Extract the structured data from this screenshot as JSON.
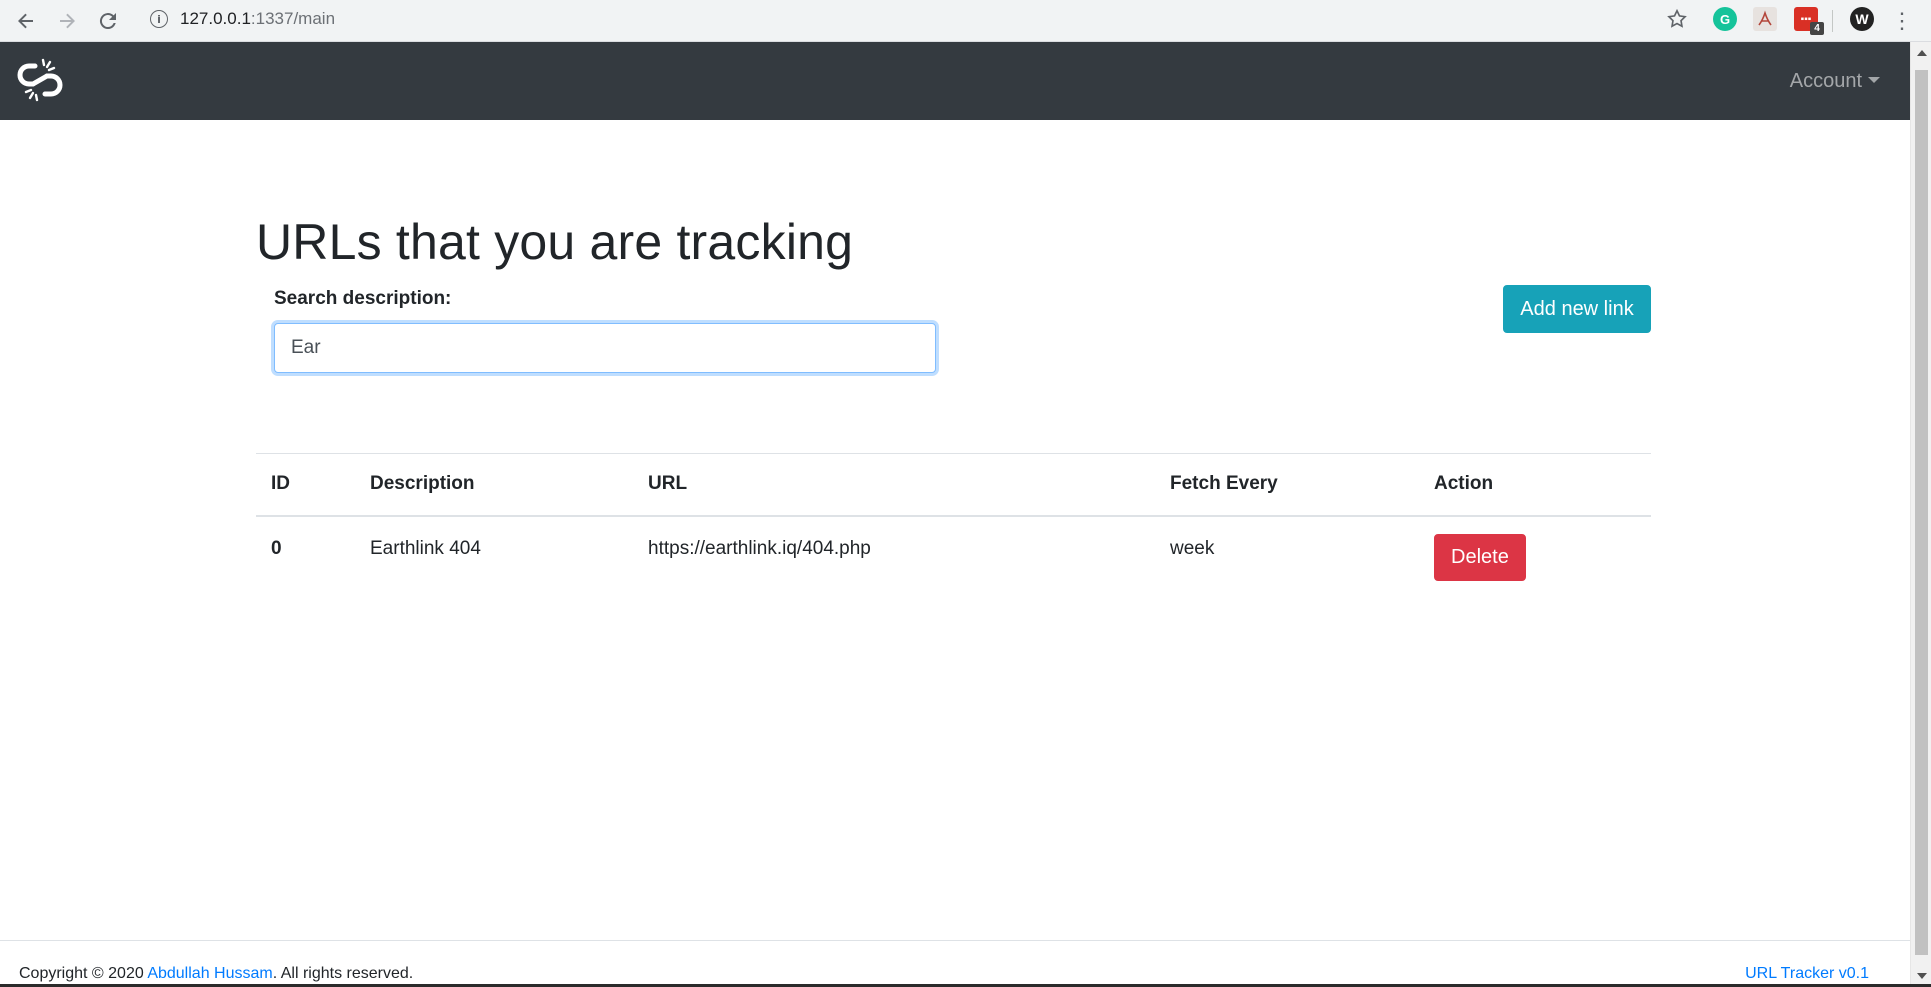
{
  "browser": {
    "url_host": "127.0.0.1",
    "url_path": ":1337/main",
    "extensions": [
      {
        "name": "grammarly-icon",
        "glyph": "G"
      },
      {
        "name": "pdf-icon",
        "glyph": "⅄"
      },
      {
        "name": "calendar-icon",
        "glyph": "▪▪▪",
        "badge": "4"
      },
      {
        "name": "wordpress-icon",
        "glyph": "W"
      }
    ]
  },
  "navbar": {
    "brand_icon": "broken-link-icon",
    "account_label": "Account"
  },
  "main": {
    "title": "URLs that you are tracking",
    "search": {
      "label": "Search description:",
      "value": "Ear"
    },
    "add_button_label": "Add new link",
    "table": {
      "headers": [
        "ID",
        "Description",
        "URL",
        "Fetch Every",
        "Action"
      ],
      "rows": [
        {
          "id": "0",
          "description": "Earthlink 404",
          "url": "https://earthlink.iq/404.php",
          "fetch_every": "week",
          "action_label": "Delete"
        }
      ]
    }
  },
  "footer": {
    "copyright_prefix": "Copyright © 2020 ",
    "author": "Abdullah Hussam",
    "copyright_suffix": ". All rights reserved.",
    "version": "URL Tracker v0.1"
  },
  "colors": {
    "navbar": "#343a40",
    "primary_info": "#17a2b8",
    "danger": "#dc3545",
    "link": "#007bff"
  }
}
